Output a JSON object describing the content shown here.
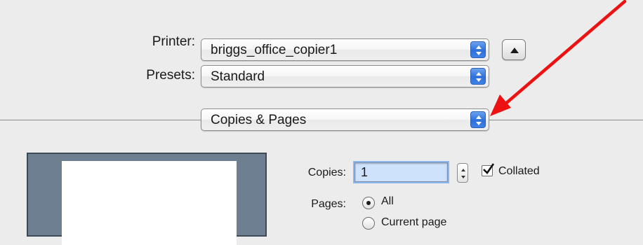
{
  "printer": {
    "label": "Printer:",
    "value": "briggs_office_copier1"
  },
  "presets": {
    "label": "Presets:",
    "value": "Standard"
  },
  "section": {
    "value": "Copies & Pages"
  },
  "copies": {
    "label": "Copies:",
    "value": "1",
    "collated_label": "Collated",
    "collated_checked": true
  },
  "pages": {
    "label": "Pages:",
    "options": [
      "All",
      "Current page"
    ],
    "selected": "All"
  },
  "colors": {
    "accent": "#3a7ae0",
    "arrow": "#ee1111"
  }
}
